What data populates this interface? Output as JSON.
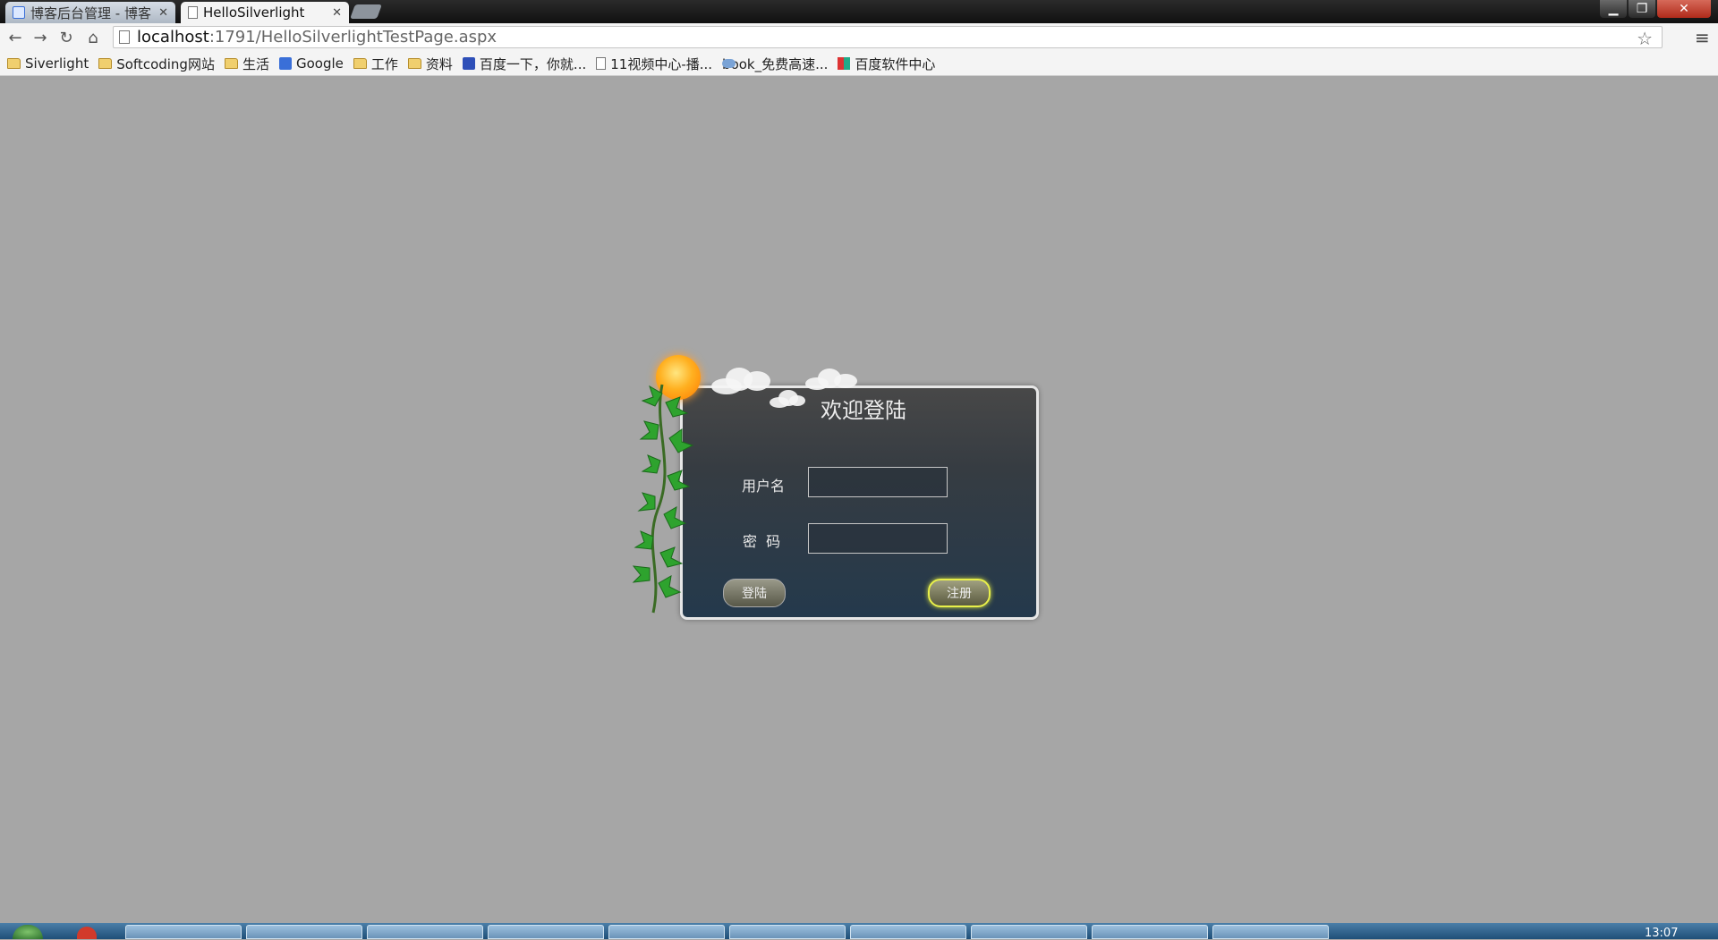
{
  "browser": {
    "tabs": [
      {
        "title": "博客后台管理 - 博客",
        "active": false
      },
      {
        "title": "HelloSilverlight",
        "active": true
      }
    ],
    "address": {
      "host": "localhost",
      "path": ":1791/HelloSilverlightTestPage.aspx"
    },
    "bookmarks": [
      {
        "label": "Siverlight",
        "icon": "folder-icon"
      },
      {
        "label": "Softcoding网站",
        "icon": "folder-icon"
      },
      {
        "label": "生活",
        "icon": "folder-icon"
      },
      {
        "label": "Google",
        "icon": "google-icon"
      },
      {
        "label": "工作",
        "icon": "folder-icon"
      },
      {
        "label": "资料",
        "icon": "folder-icon"
      },
      {
        "label": "百度一下，你就...",
        "icon": "baidu-icon"
      },
      {
        "label": "11视频中心-播...",
        "icon": "page-icon"
      },
      {
        "label": "book_免费高速...",
        "icon": "cloud-icon"
      },
      {
        "label": "百度软件中心",
        "icon": "baidu-software-icon"
      }
    ]
  },
  "login": {
    "title": "欢迎登陆",
    "username_label": "用户名",
    "password_label": "密  码",
    "username_value": "",
    "password_value": "",
    "login_button": "登陆",
    "register_button": "注册"
  },
  "taskbar": {
    "clock": "13:07"
  },
  "colors": {
    "page_background": "#a6a6a6",
    "register_glow": "#e8f04a"
  }
}
